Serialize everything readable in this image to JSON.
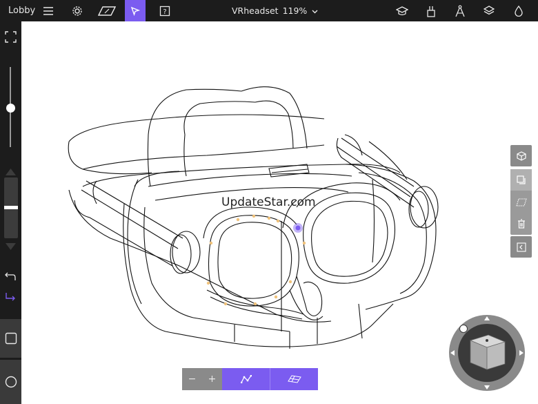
{
  "app": {
    "lobby_label": "Lobby",
    "document_name": "VRheadset",
    "zoom": "119%"
  },
  "topbar": {
    "icons": [
      "menu-icon",
      "gear-icon",
      "plane-icon",
      "select-arrow-icon",
      "help-icon",
      "learn-icon",
      "paint-icon",
      "compass-icon",
      "layers-icon",
      "drop-icon"
    ],
    "accent": "#7b5cf0"
  },
  "watermark": "UpdateStar.com",
  "bottom_toolbar": {
    "minus": "−",
    "plus": "+"
  },
  "colors": {
    "bar_bg": "#1c1c1c",
    "accent": "#7b5cf0",
    "panel_gray": "#8a8a8a",
    "control_point": "#f0c27a"
  }
}
